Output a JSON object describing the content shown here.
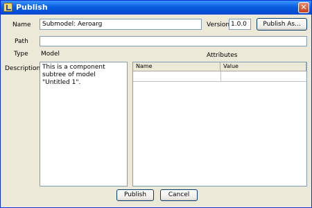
{
  "window": {
    "title": "Publish",
    "close_glyph": "✕"
  },
  "form": {
    "name_label": "Name",
    "name_value": "Submodel: Aeroarg",
    "version_label": "Version",
    "version_value": "1.0.0",
    "publish_as_label": "Publish As...",
    "path_label": "Path",
    "path_value": "",
    "type_label": "Type",
    "type_value": "Model",
    "description_label": "Description",
    "description_value": "This is a component subtree of model \"Untitled 1\"."
  },
  "attributes": {
    "label": "Attributes",
    "columns": [
      "Name",
      "Value"
    ]
  },
  "footer": {
    "publish_label": "Publish",
    "cancel_label": "Cancel"
  }
}
